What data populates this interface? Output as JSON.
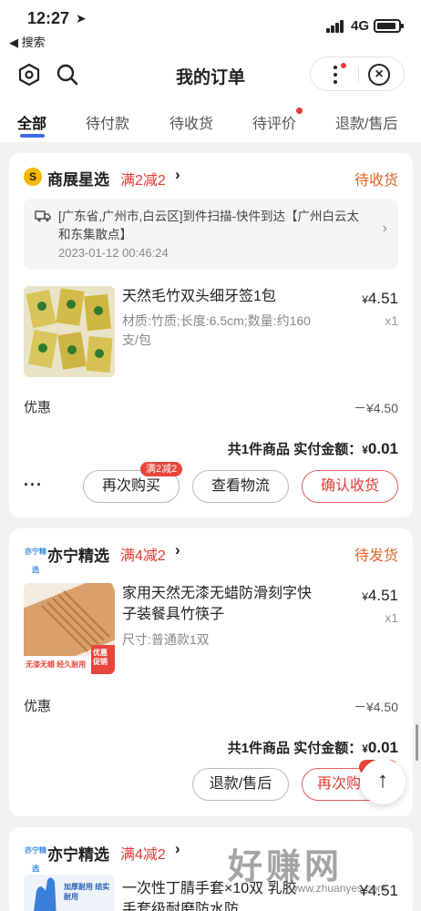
{
  "status_bar": {
    "time": "12:27",
    "location_icon": "location-arrow-icon",
    "back_label": "◀ 搜索",
    "network": "4G"
  },
  "header": {
    "title": "我的订单",
    "left_icons": [
      "settings-hexagon-icon",
      "search-icon"
    ],
    "capsule_icons": [
      "more-dots-icon",
      "close-circle-icon"
    ]
  },
  "tabs": [
    {
      "label": "全部",
      "active": true
    },
    {
      "label": "待付款"
    },
    {
      "label": "待收货"
    },
    {
      "label": "待评价",
      "dot": true
    },
    {
      "label": "退款/售后"
    }
  ],
  "orders": [
    {
      "shop_name": "商展星选",
      "promo": "满2减2",
      "status": "待收货",
      "logistics_text": "[广东省,广州市,白云区]到件扫描-快件到达【广州白云太和东集散点】",
      "logistics_time": "2023-01-12 00:46:24",
      "product_name": "天然毛竹双头细牙签1包",
      "product_spec": "材质:竹质;长度:6.5cm;数量:约160支/包",
      "price_symbol": "¥",
      "price_int": "4.",
      "price_dec": "51",
      "qty": "x1",
      "discount_label": "优惠",
      "discount_value": "－¥4.50",
      "total_prefix": "共1件商品  实付金额：",
      "total_symbol": "¥",
      "total_int": "0.",
      "total_dec": "01",
      "more": "···",
      "buttons": [
        "再次购买",
        "查看物流",
        "确认收货"
      ],
      "button_badge": "满2减2"
    },
    {
      "shop_name": "亦宁精选",
      "shop_logo_text": "亦宁精选",
      "promo": "满4减2",
      "status": "待发货",
      "product_name": "家用天然无漆无蜡防滑刻字快子装餐具竹筷子",
      "product_spec": "尺寸:普通款1双",
      "thumb_tag": "无漆无蜡 经久耐用",
      "thumb_badge": "优惠促销",
      "price_symbol": "¥",
      "price_int": "4.",
      "price_dec": "51",
      "qty": "x1",
      "discount_label": "优惠",
      "discount_value": "－¥4.50",
      "total_prefix": "共1件商品  实付金额：",
      "total_symbol": "¥",
      "total_int": "0.",
      "total_dec": "01",
      "buttons": [
        "退款/售后",
        "再次购"
      ]
    },
    {
      "shop_name": "亦宁精选",
      "shop_logo_text": "亦宁精选",
      "promo": "满4减2",
      "product_name": "一次性丁腈手套×10双 乳胶手套级耐磨防水防",
      "thumb_tag": "加厚耐用 结实耐用",
      "price_partial": "¥4.51"
    }
  ],
  "fab_label": "↑",
  "watermark": {
    "text": "好赚网",
    "url": "www.zhuanyes.com"
  },
  "colors": {
    "accent_red": "#e53935",
    "status_orange": "#e0642b",
    "tab_blue": "#3b6bea"
  }
}
